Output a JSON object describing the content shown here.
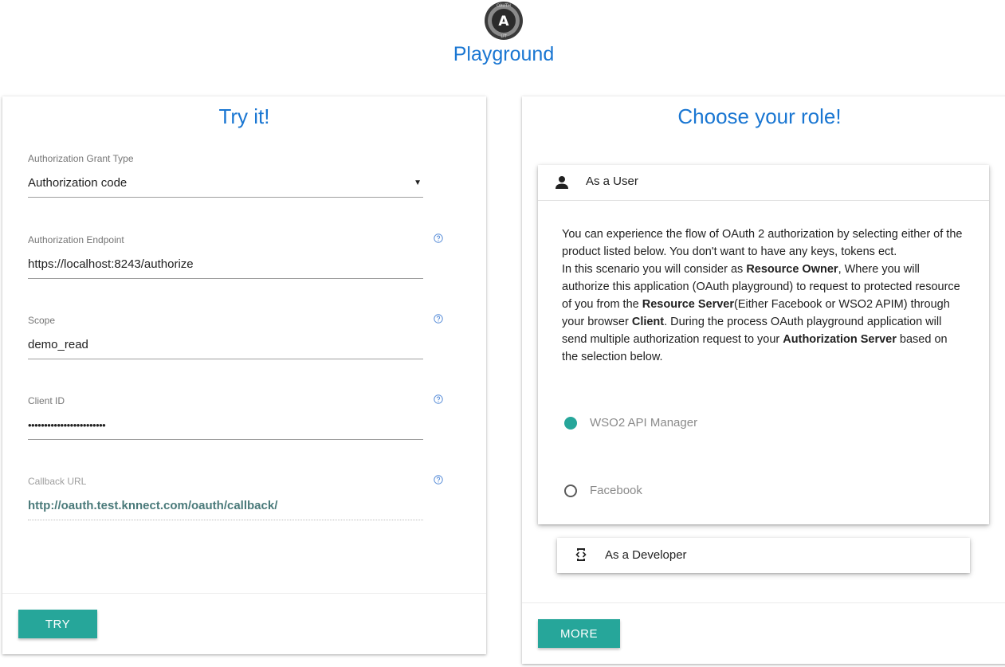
{
  "header": {
    "brand": "Playground",
    "logo_icon": "oauth-logo-icon",
    "logo_top_text": "OAUTH",
    "logo_letter": "A",
    "logo_bottom_text": "LIT"
  },
  "try_panel": {
    "title": "Try it!",
    "fields": {
      "grant_type": {
        "label": "Authorization Grant Type",
        "value": "Authorization code",
        "icon": "dropdown-triangle-icon"
      },
      "auth_endpoint": {
        "label": "Authorization Endpoint",
        "value": "https://localhost:8243/authorize",
        "icon": "help-circle-icon"
      },
      "scope": {
        "label": "Scope",
        "value": "demo_read",
        "icon": "help-circle-icon"
      },
      "client_id": {
        "label": "Client ID",
        "value": "••••••••••••••••••••••••",
        "icon": "help-circle-icon"
      },
      "callback_url": {
        "label": "Callback URL",
        "value": "http://oauth.test.knnect.com/oauth/callback/",
        "icon": "help-circle-icon"
      }
    },
    "try_button": "TRY"
  },
  "role_panel": {
    "title": "Choose your role!",
    "user_section": {
      "label": "As a User",
      "icon": "person-icon",
      "desc_1": "You can experience the flow of OAuth 2 authorization by selecting either of the product listed below. You don't want to have any keys, tokens ect.",
      "desc_2a": "In this scenario you will consider as ",
      "desc_2b": "Resource Owner",
      "desc_2c": ", Where you will authorize this application (OAuth playground) to request to protected resource of you from the ",
      "desc_2d": "Resource Server",
      "desc_2e": "(Either Facebook or WSO2 APIM) through your browser ",
      "desc_2f": "Client",
      "desc_2g": ". During the process OAuth playground application will send multiple authorization request to your ",
      "desc_2h": "Authorization Server",
      "desc_2i": " based on the selection below.",
      "options": [
        {
          "label": "WSO2 API Manager",
          "selected": true
        },
        {
          "label": "Facebook",
          "selected": false
        }
      ]
    },
    "developer_section": {
      "label": "As a Developer",
      "icon": "developer-mode-icon"
    },
    "more_button": "MORE"
  },
  "colors": {
    "brand_blue": "#1976d2",
    "accent_teal": "#26a69a"
  }
}
